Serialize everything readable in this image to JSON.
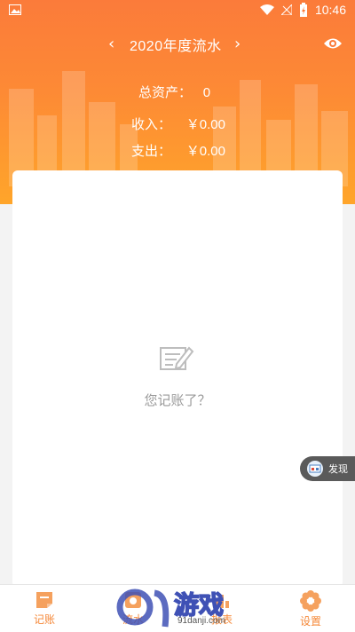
{
  "status_bar": {
    "time": "10:46"
  },
  "header": {
    "title": "2020年度流水",
    "total_assets_label": "总资产：",
    "total_assets_value": "0",
    "income_label": "收入：",
    "income_value": "￥0.00",
    "expense_label": "支出：",
    "expense_value": "￥0.00"
  },
  "empty_state": {
    "message": "您记账了？"
  },
  "discover_button": {
    "label": "发现"
  },
  "tabbar": {
    "items": [
      {
        "label": "记账",
        "icon": "note-icon"
      },
      {
        "label": "流水",
        "icon": "flow-icon"
      },
      {
        "label": "报表",
        "icon": "chart-icon"
      },
      {
        "label": "设置",
        "icon": "settings-icon"
      }
    ]
  },
  "watermark": {
    "text": "游戏",
    "url": "91danji.com"
  },
  "colors": {
    "accent": "#f5893a",
    "header_top": "#fb7b3a",
    "header_bottom": "#ffa52a"
  }
}
